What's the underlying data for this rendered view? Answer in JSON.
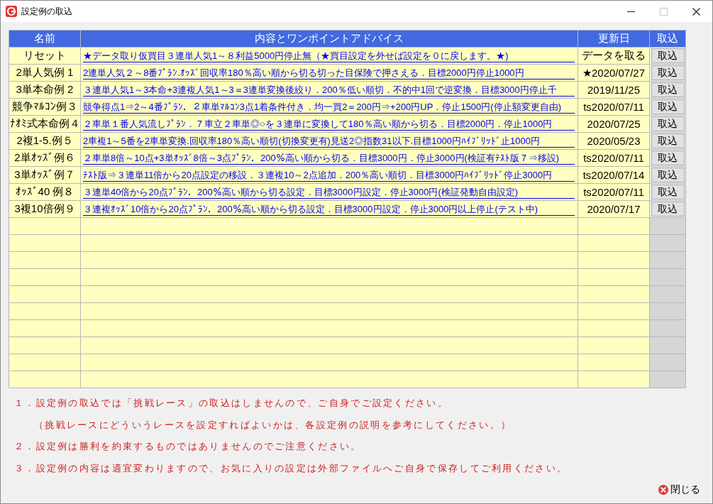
{
  "window": {
    "title": "設定例の取込",
    "controls": [
      {
        "kind": "minimize",
        "disabled": false
      },
      {
        "kind": "maximize",
        "disabled": true
      },
      {
        "kind": "close",
        "disabled": false
      }
    ]
  },
  "table": {
    "columns": [
      "名前",
      "内容とワンポイントアドバイス",
      "更新日",
      "取込"
    ],
    "rows": [
      {
        "name": "リセット",
        "advice": "★データ取り仮買目３連単人気1～８利益5000円停止無（★買目設定を外せば設定を０に戻します。★)",
        "updated": "データを取る",
        "button": "取込"
      },
      {
        "name": "2単人気例 1",
        "advice": "2連単人気２～8番ﾌﾟﾗﾝ.ｵｯｽﾞ回収率180％高い順から切る切った目保険で押さえる．目標2000円停止1000円",
        "updated": "★2020/07/27",
        "button": "取込"
      },
      {
        "name": "3単本命例 2",
        "advice": "３連単人気1～3本命+3連複人気1～3＝3連単変換後絞り．200％低い順切．不的中1回で逆変換．目標3000円停止千",
        "updated": "2019/11/25",
        "button": "取込"
      },
      {
        "name": "競争ﾏﾙｺﾝ例３",
        "advice": "競争得点1⇒2～4番ﾌﾟﾗﾝ．２車単ﾏﾙｺﾝ3点1着条件付き．均一買2＝200円⇒+200円UP．停止1500円(停止額変更自由)",
        "updated": "ts2020/07/11",
        "button": "取込"
      },
      {
        "name": "ﾅｵﾐ式本命例４",
        "advice": "２車単１番人気流しﾌﾟﾗﾝ．７車立２車単◎○を３連単に変換して180％高い順から切る．目標2000円．停止1000円",
        "updated": "2020/07/25",
        "button": "取込"
      },
      {
        "name": "2複1-5.例５",
        "advice": "2車複1～5番を2車単変換.回収率180％高い順切(切換変更有)見送2◎指数31以下.目標1000円ﾊｲﾌﾞﾘｯﾄﾞ止1000円",
        "updated": "2020/05/23",
        "button": "取込"
      },
      {
        "name": "2単ｵｯｽﾞ例６",
        "advice": "２車単8倍～10点+3単ｵｯｽﾞ8倍～3点ﾌﾟﾗﾝ．200％高い順から切る．目標3000円．停止3000円(検証有ﾃｽﾄ版７⇒移設)",
        "updated": "ts2020/07/11",
        "button": "取込"
      },
      {
        "name": "3単ｵｯｽﾞ例７",
        "advice": "ﾃｽﾄ版⇒３連単11倍から20点設定の移設．３連複10～2点追加．200％高い順切．目標3000円ﾊｲﾌﾞﾘｯﾄﾞ停止3000円",
        "updated": "ts2020/07/14",
        "button": "取込"
      },
      {
        "name": "ｵｯｽﾞ40 例８",
        "advice": "３連単40倍から20点ﾌﾟﾗﾝ．200％高い順から切る設定．目標3000円設定．停止3000円(検証発動自由設定)",
        "updated": "ts2020/07/11",
        "button": "取込"
      },
      {
        "name": "3複10倍例９",
        "advice": "３連複ｵｯｽﾞ10倍から20点ﾌﾟﾗﾝ．200％高い順から切る設定．目標3000円設定．停止3000円以上停止(テスト中)",
        "updated": "2020/07/17",
        "button": "取込"
      }
    ]
  },
  "notes": [
    {
      "kind": "item",
      "text": "１．設定例の取込では「挑戦レース」の取込はしませんので、ご自身でご設定ください。"
    },
    {
      "kind": "continuation",
      "text": "（挑戦レースにどういうレースを設定すればよいかは、各設定例の説明を参考にしてください。）"
    },
    {
      "kind": "item",
      "text": "２．設定例は勝利を約束するものではありませんのでご注意ください。"
    },
    {
      "kind": "item",
      "text": "３．設定例の内容は適宜変わりますので、お気に入りの設定は外部ファイルへご自身で保存してご利用ください。"
    }
  ],
  "close_button": {
    "label": "閉じる"
  }
}
